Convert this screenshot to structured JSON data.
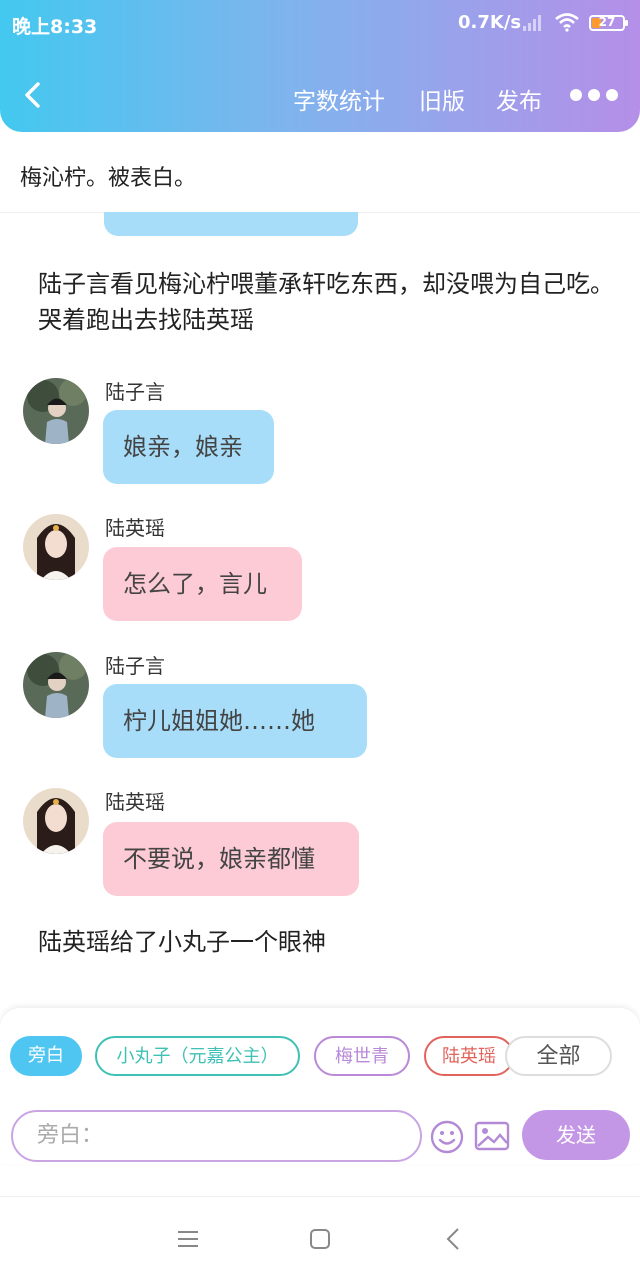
{
  "status_bar": {
    "time": "晚上8:33",
    "network_speed": "0.7K/s",
    "battery": "27",
    "battery_level": 0.27
  },
  "header": {
    "actions": [
      "字数统计",
      "旧版",
      "发布"
    ],
    "back_icon": "chevron-left-icon",
    "more_icon": "more-dots-icon"
  },
  "title": "梅沁柠。被表白。",
  "chat": {
    "narration_1": "陆子言看见梅沁柠喂董承轩吃东西，却没喂为自己吃。哭着跑出去找陆英瑶",
    "messages": [
      {
        "speaker": "陆子言",
        "text": "娘亲，娘亲",
        "color": "blue"
      },
      {
        "speaker": "陆英瑶",
        "text": "怎么了，言儿",
        "color": "pink"
      },
      {
        "speaker": "陆子言",
        "text": "柠儿姐姐她……她",
        "color": "blue"
      },
      {
        "speaker": "陆英瑶",
        "text": "不要说，娘亲都懂",
        "color": "pink"
      }
    ],
    "narration_2": "陆英瑶给了小丸子一个眼神"
  },
  "input": {
    "chips": [
      "旁白",
      "小丸子（元嘉公主）",
      "梅世青",
      "陆英瑶",
      "全部"
    ],
    "placeholder": "旁白：",
    "send_label": "发送"
  },
  "colors": {
    "header_start": "#43c8ef",
    "header_end": "#b58fe8",
    "bubble_blue": "#a7ddf8",
    "bubble_pink": "#fccbd5",
    "send": "#c497e6"
  }
}
